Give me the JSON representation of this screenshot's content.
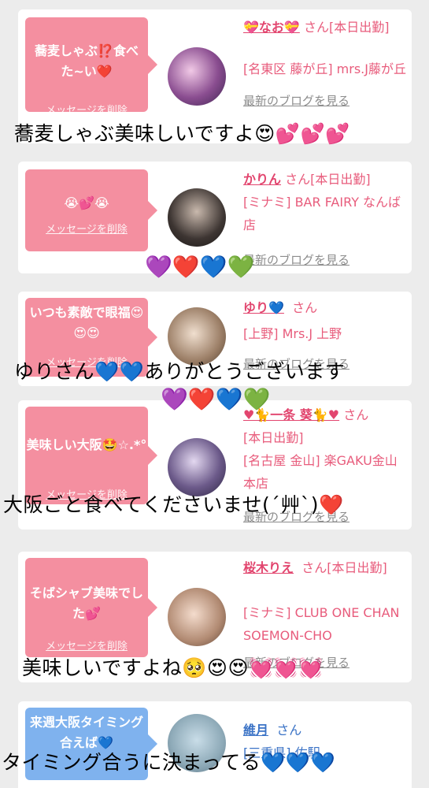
{
  "cards": [
    {
      "message": "蕎麦しゃぶ⁉️食べた~い❤️",
      "delete": "メッセージを削除",
      "name": "💝なお💝",
      "san": "さん",
      "status": "[本日出勤]",
      "shop": "[名東区 藤が丘] mrs.J藤が丘",
      "blog": "最新のブログを見る"
    },
    {
      "message": "😭💕😭",
      "delete": "メッセージを削除",
      "name": "かりん",
      "san": "さん",
      "status": "[本日出勤]",
      "shop": "[ミナミ] BAR FAIRY なんば店",
      "blog": "最新のブログを見る"
    },
    {
      "message": "いつも素敵で眼福😍😍😍",
      "delete": "メッセージを削除",
      "name": "ゆり💙",
      "san": "さん",
      "status": "",
      "shop": "[上野] Mrs.J 上野",
      "blog": "最新のブログを見る"
    },
    {
      "message": "美味しい大阪🤩☆.*°",
      "delete": "メッセージを削除",
      "name": "♥🐈一条 葵🐈♥",
      "san": "さん",
      "status": "[本日出勤]",
      "shop": "[名古屋 金山] 楽GAKU金山本店",
      "blog": "最新のブログを見る"
    },
    {
      "message": "そばシャブ美味でした💕",
      "delete": "メッセージを削除",
      "name": "桜木りえ",
      "san": "さん",
      "status": "[本日出勤]",
      "shop": "[ミナミ] CLUB ONE CHAN SOEMON-CHO",
      "blog": "最新のブログを見る"
    },
    {
      "message": "来週大阪タイミング合えば💙",
      "delete": "",
      "name": "維月",
      "san": "さん",
      "status": "",
      "shop": "[三重県] 佐駅",
      "blog": ""
    }
  ],
  "captions": [
    "蕎麦しゃぶ美味しいですよ😍💕💕💕",
    "ゆりさん💙💙ありがとうございます",
    "大阪ごと食べてくださいませ(´艸`)❤️",
    "美味しいですよね🥺😍😍💓💓💓",
    "タイミング合うに決まってる💙💙💙"
  ],
  "heart_rows": [
    [
      "💜",
      "❤️",
      "💙",
      "💚"
    ],
    [
      "💜",
      "❤️",
      "💙",
      "💚"
    ]
  ]
}
